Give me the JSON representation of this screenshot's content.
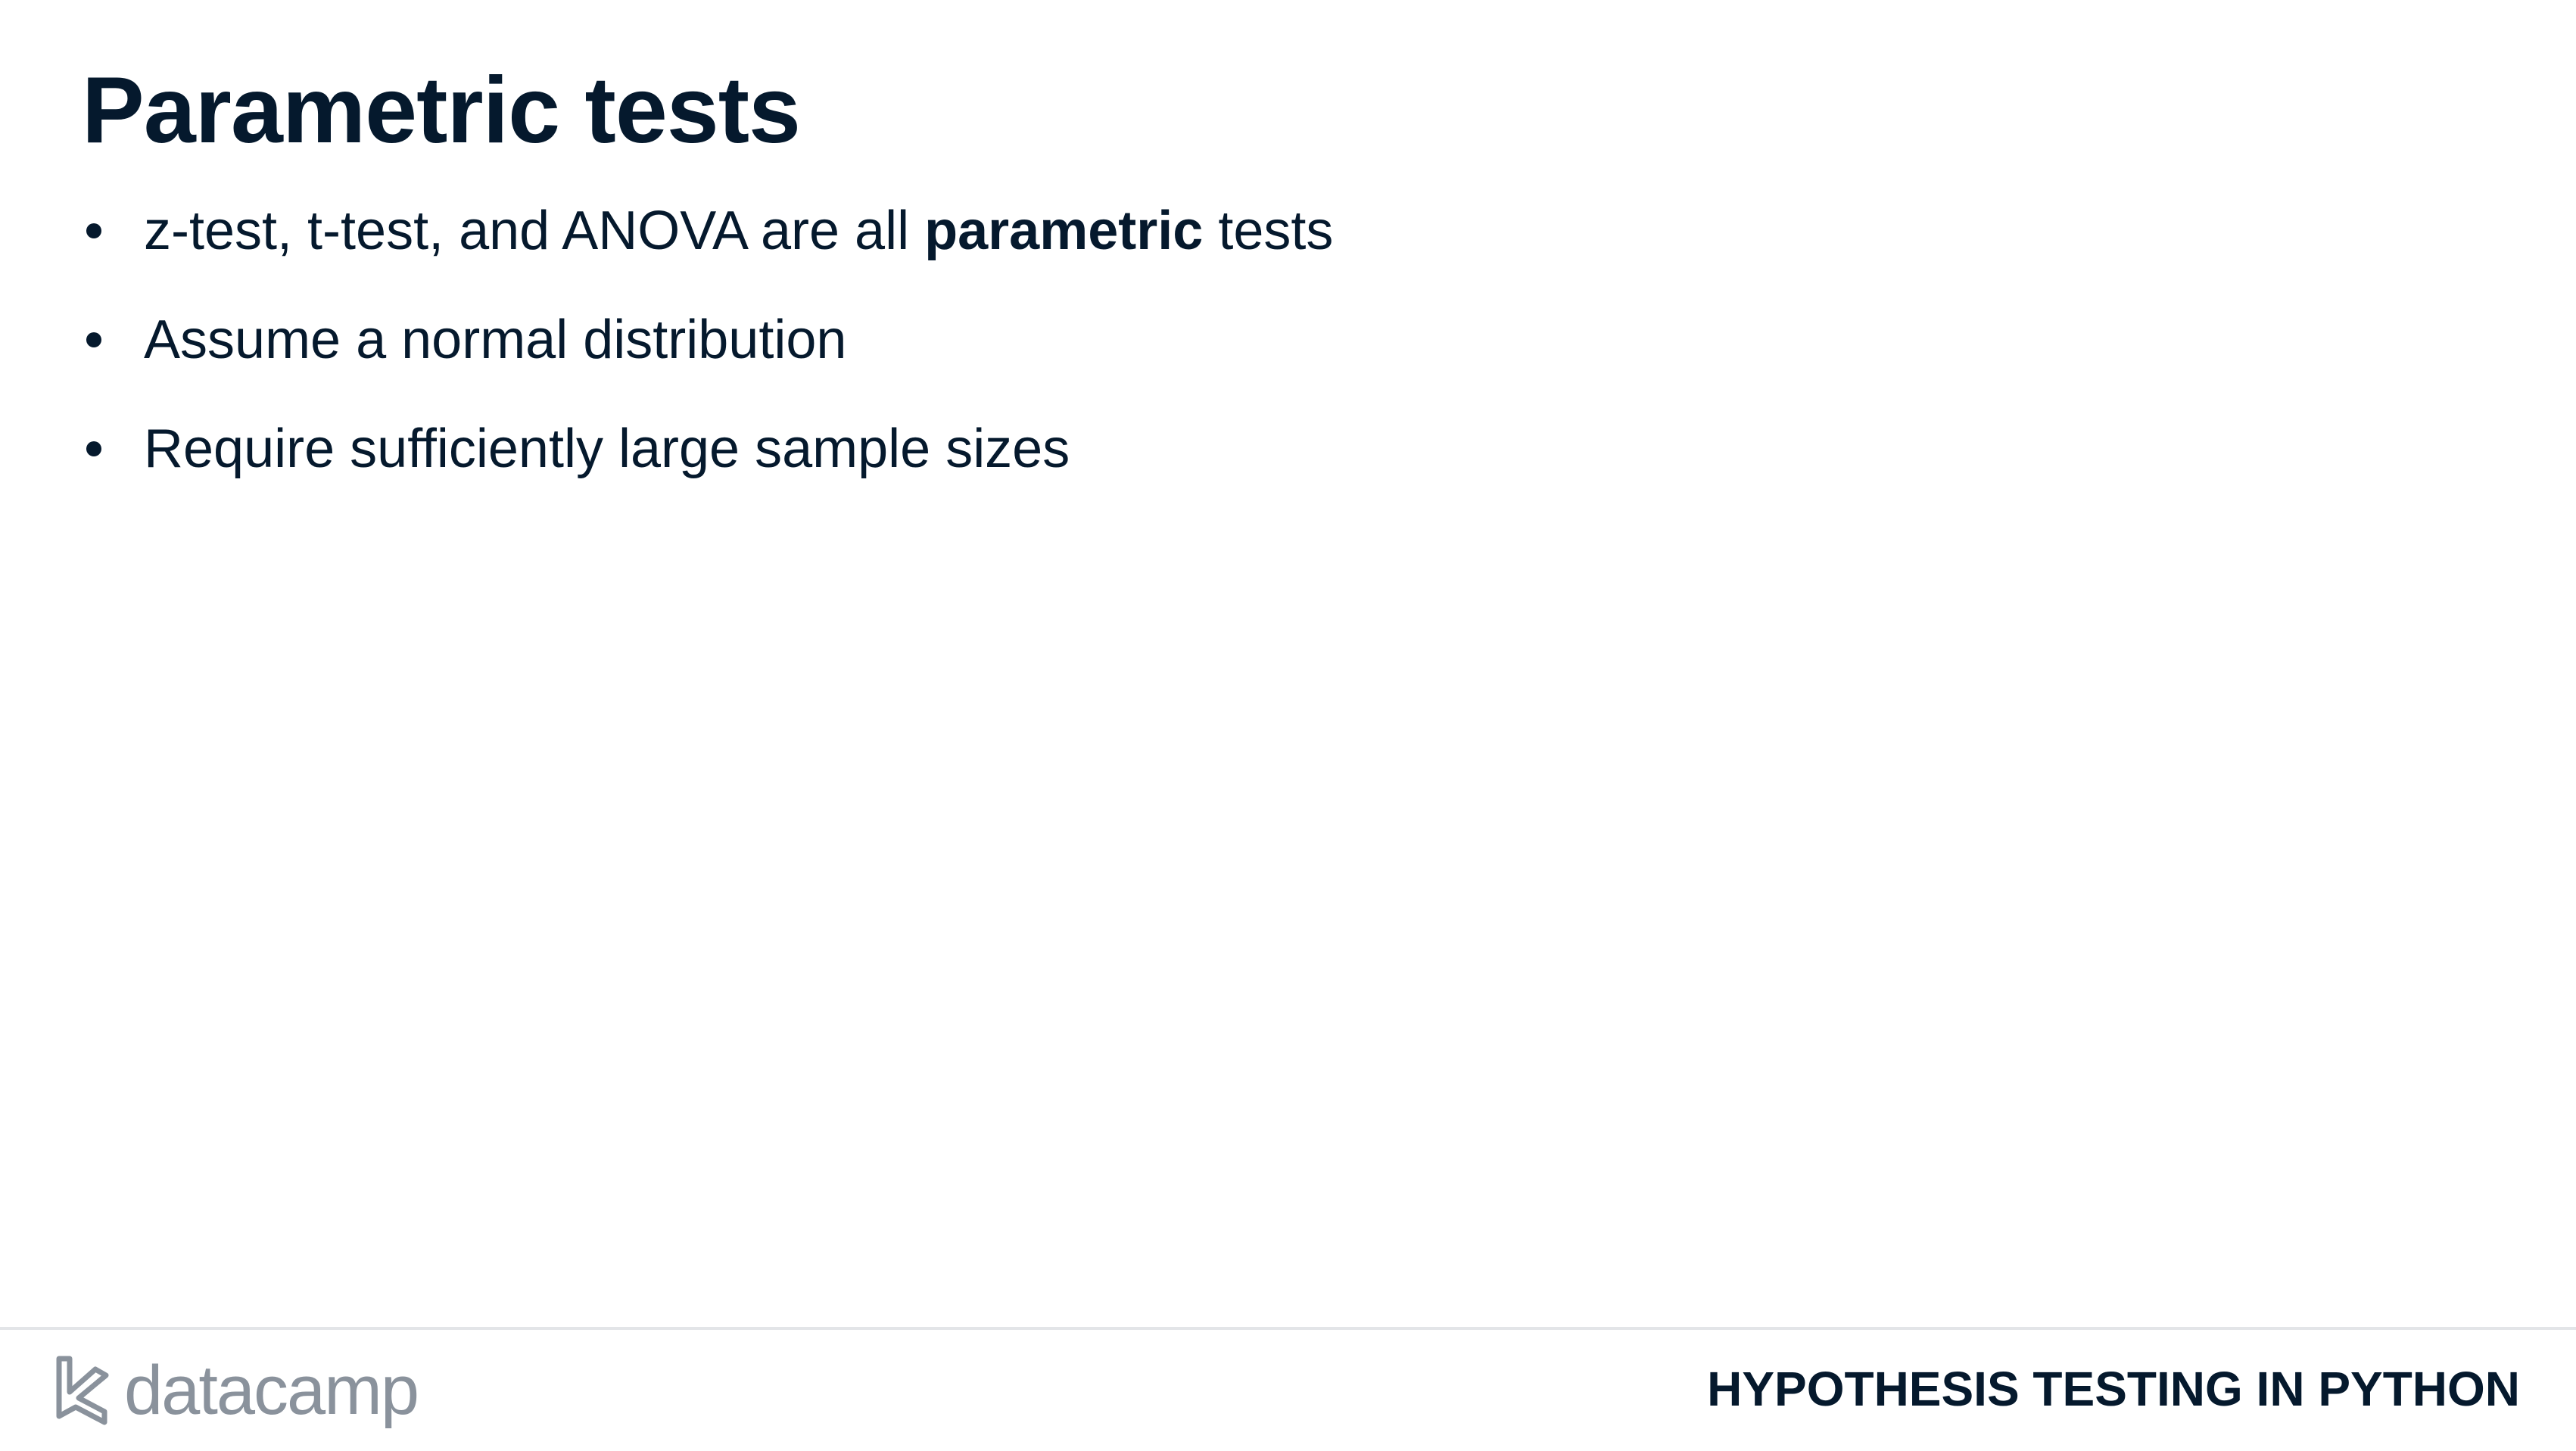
{
  "slide": {
    "title": "Parametric tests",
    "bullets": [
      {
        "before": "z-test, t-test, and ANOVA are all ",
        "bold": "parametric",
        "after": " tests"
      },
      {
        "text": "Assume a normal distribution"
      },
      {
        "text": "Require sufficiently large sample sizes"
      }
    ]
  },
  "footer": {
    "logo_text": "datacamp",
    "logo_icon": "datacamp-logo-icon",
    "course_name": "HYPOTHESIS TESTING IN PYTHON"
  },
  "colors": {
    "text": "#05192d",
    "logo": "#8a929c",
    "divider": "#e3e5e8"
  }
}
